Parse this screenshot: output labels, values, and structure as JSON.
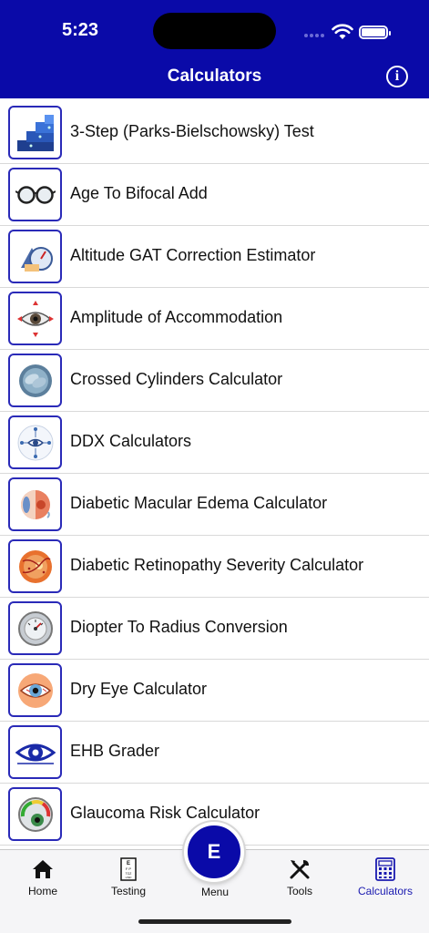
{
  "status_bar": {
    "time": "5:23"
  },
  "header": {
    "title": "Calculators",
    "info_icon": "info-icon"
  },
  "items": [
    {
      "label": "3-Step (Parks-Bielschowsky) Test",
      "icon": "stairs-icon"
    },
    {
      "label": "Age To Bifocal Add",
      "icon": "eyeglasses-icon"
    },
    {
      "label": "Altitude GAT Correction Estimator",
      "icon": "altitude-gauge-icon"
    },
    {
      "label": "Amplitude of Accommodation",
      "icon": "eye-arrows-icon"
    },
    {
      "label": "Crossed Cylinders Calculator",
      "icon": "cylinders-icon"
    },
    {
      "label": "DDX Calculators",
      "icon": "ddx-network-icon"
    },
    {
      "label": "Diabetic Macular Edema Calculator",
      "icon": "eyeball-icon"
    },
    {
      "label": "Diabetic Retinopathy Severity Calculator",
      "icon": "retina-icon"
    },
    {
      "label": "Diopter To Radius Conversion",
      "icon": "keratometer-icon"
    },
    {
      "label": "Dry Eye Calculator",
      "icon": "dry-eye-icon"
    },
    {
      "label": "EHB Grader",
      "icon": "eye-logo-icon"
    },
    {
      "label": "Glaucoma Risk Calculator",
      "icon": "glaucoma-gauge-icon"
    }
  ],
  "tabbar": {
    "home": "Home",
    "testing": "Testing",
    "menu": "Menu",
    "menu_letter": "E",
    "tools": "Tools",
    "calculators": "Calculators",
    "active_color": "#1a1ab0"
  },
  "colors": {
    "primary": "#0a0aa8",
    "icon_border": "#2a2ab8"
  }
}
